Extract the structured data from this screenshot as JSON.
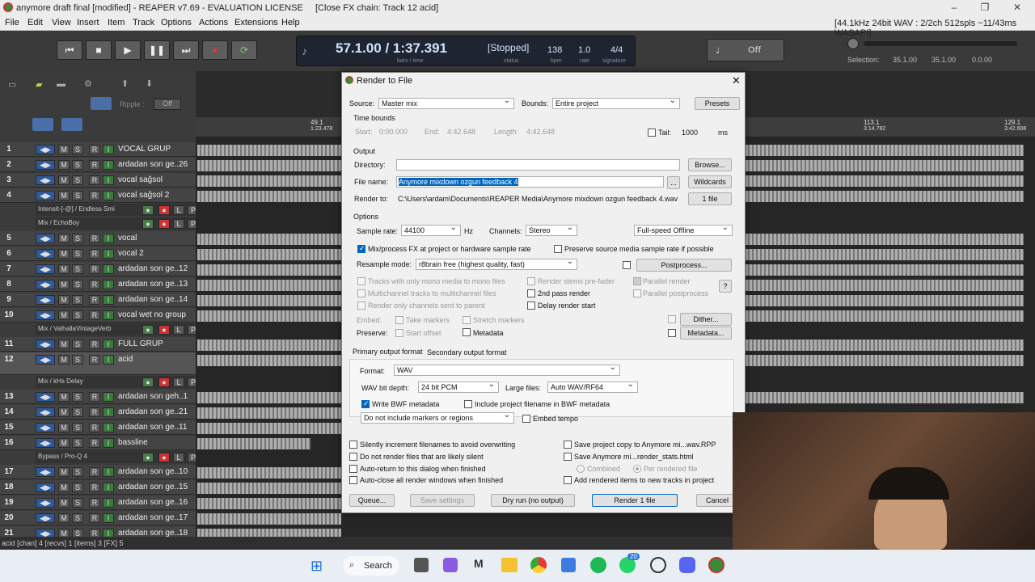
{
  "window": {
    "title": "anymore draft final [modified] - REAPER v7.69 - EVALUATION LICENSE",
    "fx_title": "[Close FX chain: Track 12 acid]",
    "audio_info": "[44.1kHz 24bit WAV : 2/2ch 512spls ~11/43ms WASAPI]"
  },
  "menu": [
    "File",
    "Edit",
    "View",
    "Insert",
    "Item",
    "Track",
    "Options",
    "Actions",
    "Extensions",
    "Help"
  ],
  "transport": {
    "time": "57.1.00 / 1:37.391",
    "time_sub": "bars / time",
    "state": "[Stopped]",
    "state_sub": "status",
    "bpm": "138",
    "bpm_sub": "bpm",
    "rate": "1.0",
    "rate_sub": "rate",
    "sig": "4/4",
    "sig_sub": "signature",
    "metro_state": "Off",
    "selection_label": "Selection:",
    "sel_start": "35.1.00",
    "sel_end": "35.1.00",
    "sel_len": "0.0.00"
  },
  "tcp_toolbar": {
    "ripple_label": "Ripple :",
    "ripple_value": "Off"
  },
  "ruler": [
    {
      "bar": "49.1",
      "time": "1:23.478"
    },
    {
      "bar": "113.1",
      "time": "3:14.782"
    },
    {
      "bar": "129.1",
      "time": "3:42.608"
    }
  ],
  "tracks": [
    {
      "num": "1",
      "name": "VOCAL GRUP"
    },
    {
      "num": "2",
      "name": "ardadan son ge..26"
    },
    {
      "num": "3",
      "name": "vocal sağsol"
    },
    {
      "num": "4",
      "name": "vocal sağsol 2"
    },
    {
      "fx": "Intensit-[-@] / Endless Smi"
    },
    {
      "fx": "Mix / EchoBoy"
    },
    {
      "num": "5",
      "name": "vocal"
    },
    {
      "num": "6",
      "name": "vocal 2"
    },
    {
      "num": "7",
      "name": "ardadan son ge..12"
    },
    {
      "num": "8",
      "name": "ardadan son ge..13"
    },
    {
      "num": "9",
      "name": "ardadan son ge..14"
    },
    {
      "num": "10",
      "name": "vocal wet no group"
    },
    {
      "fx": "Mix / ValhallaVintageVerb"
    },
    {
      "num": "11",
      "name": "FULL GRUP"
    },
    {
      "num": "12",
      "name": "acid"
    },
    {
      "fx": "Mix / kHs Delay"
    },
    {
      "num": "13",
      "name": "ardadan son geh..1"
    },
    {
      "num": "14",
      "name": "ardadan son ge..21"
    },
    {
      "num": "15",
      "name": "ardadan son ge..11"
    },
    {
      "num": "16",
      "name": "bassline"
    },
    {
      "fx": "Bypass / Pro-Q 4"
    },
    {
      "num": "17",
      "name": "ardadan son ge..10"
    },
    {
      "num": "18",
      "name": "ardadan son ge..15"
    },
    {
      "num": "19",
      "name": "ardadan son ge..16"
    },
    {
      "num": "20",
      "name": "ardadan son ge..17"
    },
    {
      "num": "21",
      "name": "ardadan son ge..18"
    }
  ],
  "status_bar": "acid [chan] 4 [recvs] 1 [items] 3 [FX] 5",
  "dialog": {
    "title": "Render to File",
    "source_label": "Source:",
    "source_value": "Master mix",
    "bounds_label": "Bounds:",
    "bounds_value": "Entire project",
    "presets": "Presets",
    "time_bounds": "Time bounds",
    "start_label": "Start:",
    "start_value": "0:00.000",
    "end_label": "End:",
    "end_value": "4:42.648",
    "length_label": "Length:",
    "length_value": "4:42.648",
    "tail_label": "Tail:",
    "tail_value": "1000",
    "tail_unit": "ms",
    "output": "Output",
    "directory_label": "Directory:",
    "directory_value": "",
    "browse": "Browse...",
    "filename_label": "File name:",
    "filename_value": "Anymore mixdown ozgun feedback 4",
    "ellipsis": "...",
    "wildcards": "Wildcards",
    "render_to_label": "Render to:",
    "render_to_value": "C:\\Users\\ardam\\Documents\\REAPER Media\\Anymore mixdown ozgun feedback 4.wav",
    "file_count": "1 file",
    "options": "Options",
    "samplerate_label": "Sample rate:",
    "samplerate_value": "44100",
    "hz": "Hz",
    "channels_label": "Channels:",
    "channels_value": "Stereo",
    "render_speed": "Full-speed Offline",
    "mixfx": "Mix/process FX at project or hardware sample rate",
    "preserve_src": "Preserve source media sample rate if possible",
    "resample_label": "Resample mode:",
    "resample_value": "r8brain free (highest quality, fast)",
    "postprocess": "Postprocess...",
    "mono_tracks": "Tracks with only mono media to mono files",
    "stems_prefader": "Render stems pre-fader",
    "parallel_render": "Parallel render",
    "multichannel": "Multichannel tracks to multichannel files",
    "second_pass": "2nd pass render",
    "parallel_post": "Parallel postprocess",
    "help": "?",
    "only_channels": "Render only channels sent to parent",
    "delay_start": "Delay render start",
    "embed_label": "Embed:",
    "take_markers": "Take markers",
    "stretch_markers": "Stretch markers",
    "dither": "Dither...",
    "preserve_label": "Preserve:",
    "start_offset": "Start offset",
    "metadata_cb": "Metadata",
    "metadata_btn": "Metadata...",
    "tab_primary": "Primary output format",
    "tab_secondary": "Secondary output format",
    "format_label": "Format:",
    "format_value": "WAV",
    "bitdepth_label": "WAV bit depth:",
    "bitdepth_value": "24 bit PCM",
    "largefiles_label": "Large files:",
    "largefiles_value": "Auto WAV/RF64",
    "write_bwf": "Write BWF metadata",
    "include_filename": "Include project filename in BWF metadata",
    "markers_value": "Do not include markers or regions",
    "embed_tempo": "Embed tempo",
    "silent_inc": "Silently increment filenames to avoid overwriting",
    "save_copy": "Save project copy to Anymore mi...wav.RPP",
    "no_silent": "Do not render files that are likely silent",
    "save_stats": "Save Anymore mi...render_stats.html",
    "auto_return": "Auto-return to this dialog when finished",
    "combined": "Combined",
    "per_file": "Per rendered file",
    "auto_close": "Auto-close all render windows when finished",
    "add_items": "Add rendered items to new tracks in project",
    "queue": "Queue...",
    "save_settings": "Save settings",
    "dry_run": "Dry run (no output)",
    "render_btn": "Render 1 file",
    "cancel": "Cancel"
  },
  "taskbar": {
    "search": "Search",
    "whatsapp_badge": "20"
  }
}
